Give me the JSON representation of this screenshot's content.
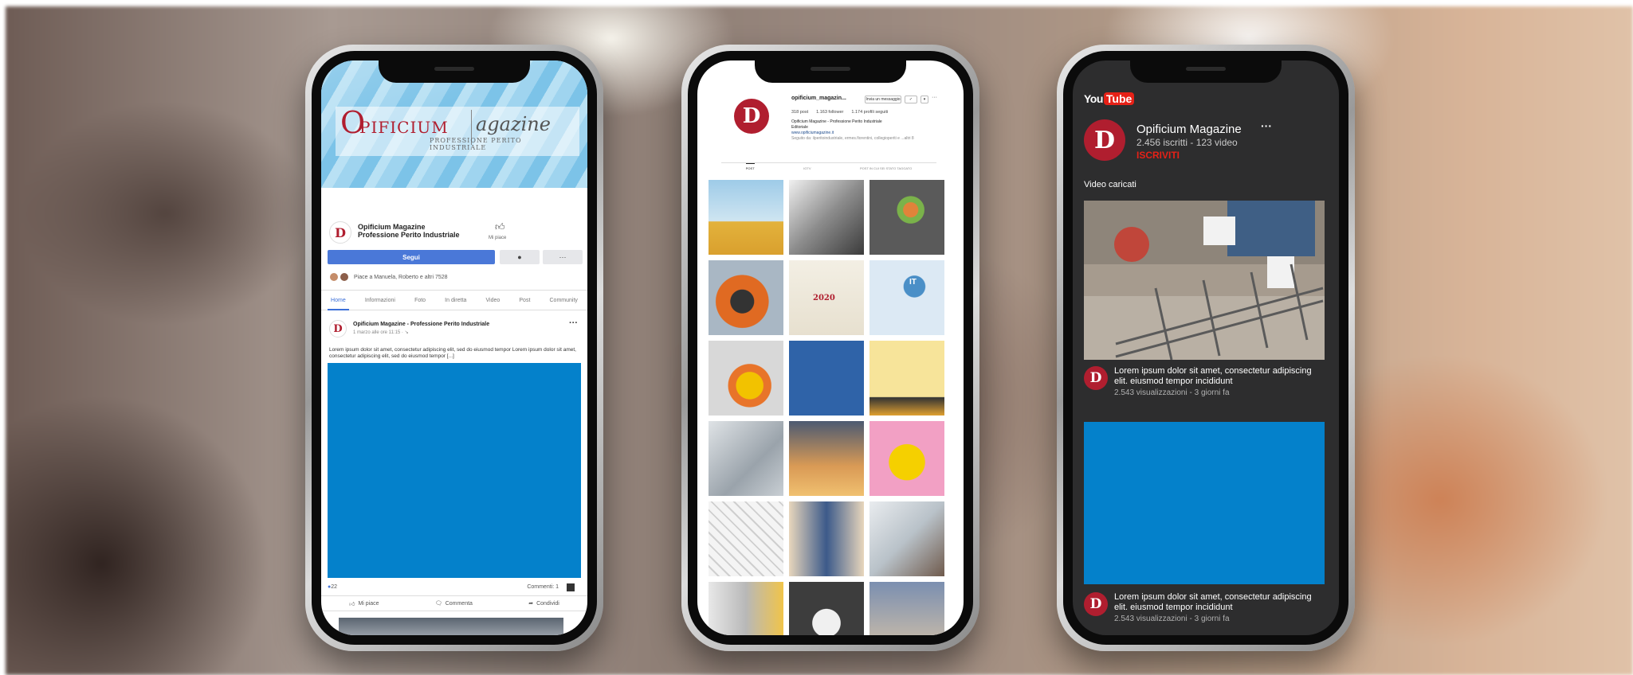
{
  "facebook": {
    "brand_letter": "O",
    "brand_word1": "PIFICIUM",
    "brand_word2": "agazine",
    "brand_sub": "PROFESSIONE PERITO INDUSTRIALE",
    "page_name_line1": "Opificium Magazine",
    "page_name_line2": "Professione Perito Industriale",
    "like_label": "Mi piace",
    "follow_label": "Segui",
    "message_icon": "●",
    "more_label": "···",
    "friends_text": "Piace a Manuela, Roberto e altri 7528",
    "tabs": [
      "Home",
      "Informazioni",
      "Foto",
      "In diretta",
      "Video",
      "Post",
      "Community"
    ],
    "post_author": "Opificium Magazine - Professione Perito Industriale",
    "post_time": "1 marzo alle ore 11:15 · ↘",
    "post_text": "Lorem ipsum dolor sit amet, consectetur adipiscing elit, sed do eiusmod tempor Lorem ipsum dolor sit amet, consectetur adipiscing elit, sed do eiusmod tempor [...]",
    "reactions_count": "22",
    "comments_count": "Commenti: 1",
    "actions": [
      "Mi piace",
      "Commenta",
      "Condividi"
    ],
    "accent": "#4a78d8"
  },
  "instagram": {
    "username": "opificium_magazin...",
    "message_button": "Invia un messaggio",
    "follow_button": "✓",
    "stats": [
      "318 post",
      "1.163 follower",
      "1.174 profili seguiti"
    ],
    "bio_name": "Opificium Magazine - Professione Perito Industriale",
    "bio_category": "Editoriale",
    "bio_link": "www.opificiumagazine.it",
    "bio_tags": "Seguito da: ilperitoindustriale, ermes.fiorentini, collegioperiti e ...altri 8",
    "tabs": [
      "POST",
      "IGTV",
      "POST IN CUI SEI STATO TAGGATO"
    ],
    "grid_labels": [
      "2020",
      "IT"
    ]
  },
  "youtube": {
    "logo_you": "You",
    "logo_tube": "Tube",
    "channel_title": "Opificium Magazine",
    "channel_stats": "2.456 iscritti - 123 video",
    "subscribe_label": "ISCRIVITI",
    "more_icon": "···",
    "section_title": "Video caricati",
    "videos": [
      {
        "title": "Lorem ipsum dolor sit amet, consectetur adipiscing elit. eiusmod tempor incididunt",
        "meta": "2.543 visualizzazioni - 3 giorni fa"
      },
      {
        "title": "Lorem ipsum dolor sit amet, consectetur adipiscing elit. eiusmod tempor incididunt",
        "meta": "2.543 visualizzazioni - 3 giorni fa"
      }
    ],
    "accent": "#e62117"
  },
  "brand_color": "#b01e2f",
  "logo_glyph": "D"
}
